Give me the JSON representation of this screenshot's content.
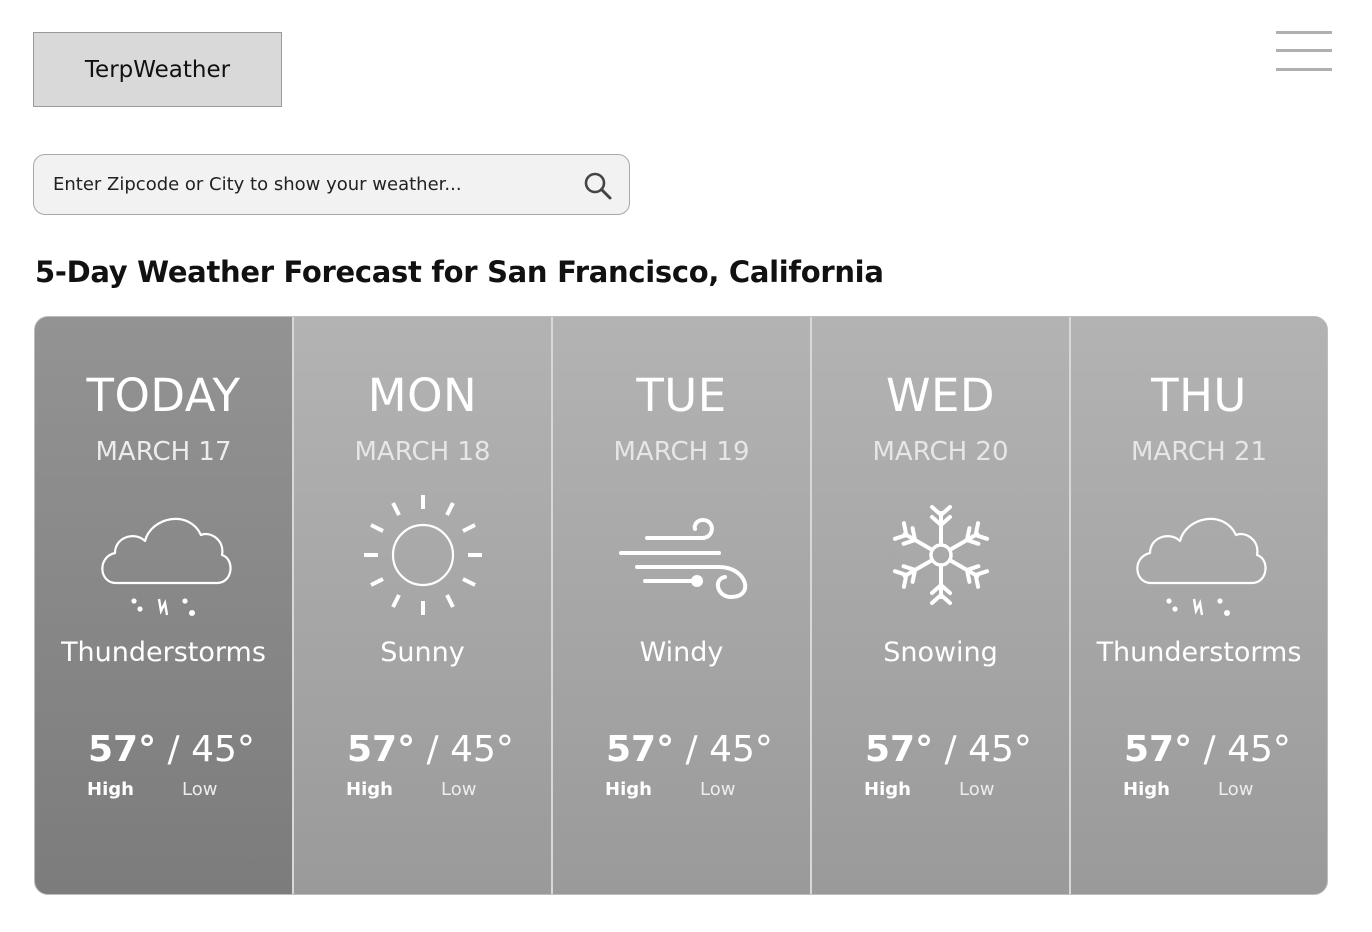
{
  "header": {
    "logo_label": "TerpWeather",
    "menu_icon": "hamburger-menu-icon"
  },
  "search": {
    "placeholder": "Enter Zipcode or City to show your weather...",
    "value": "",
    "icon": "search-icon"
  },
  "forecast": {
    "title": "5-Day Weather Forecast for San Francisco, California",
    "days": [
      {
        "day": "TODAY",
        "date": "MARCH 17",
        "condition": "Thunderstorms",
        "icon": "thunderstorm-icon",
        "high": "57°",
        "low": "45°",
        "high_label": "High",
        "low_label": "Low",
        "selected": true
      },
      {
        "day": "MON",
        "date": "MARCH 18",
        "condition": "Sunny",
        "icon": "sun-icon",
        "high": "57°",
        "low": "45°",
        "high_label": "High",
        "low_label": "Low",
        "selected": false
      },
      {
        "day": "TUE",
        "date": "MARCH 19",
        "condition": "Windy",
        "icon": "wind-icon",
        "high": "57°",
        "low": "45°",
        "high_label": "High",
        "low_label": "Low",
        "selected": false
      },
      {
        "day": "WED",
        "date": "MARCH 20",
        "condition": "Snowing",
        "icon": "snowflake-icon",
        "high": "57°",
        "low": "45°",
        "high_label": "High",
        "low_label": "Low",
        "selected": false
      },
      {
        "day": "THU",
        "date": "MARCH 21",
        "condition": "Thunderstorms",
        "icon": "thunderstorm-icon",
        "high": "57°",
        "low": "45°",
        "high_label": "High",
        "low_label": "Low",
        "selected": false
      }
    ]
  },
  "colors": {
    "card_selected": "#888888",
    "card_default": "#a8a8a8",
    "logo_bg": "#d9d9d9",
    "search_bg": "#f2f2f2"
  }
}
